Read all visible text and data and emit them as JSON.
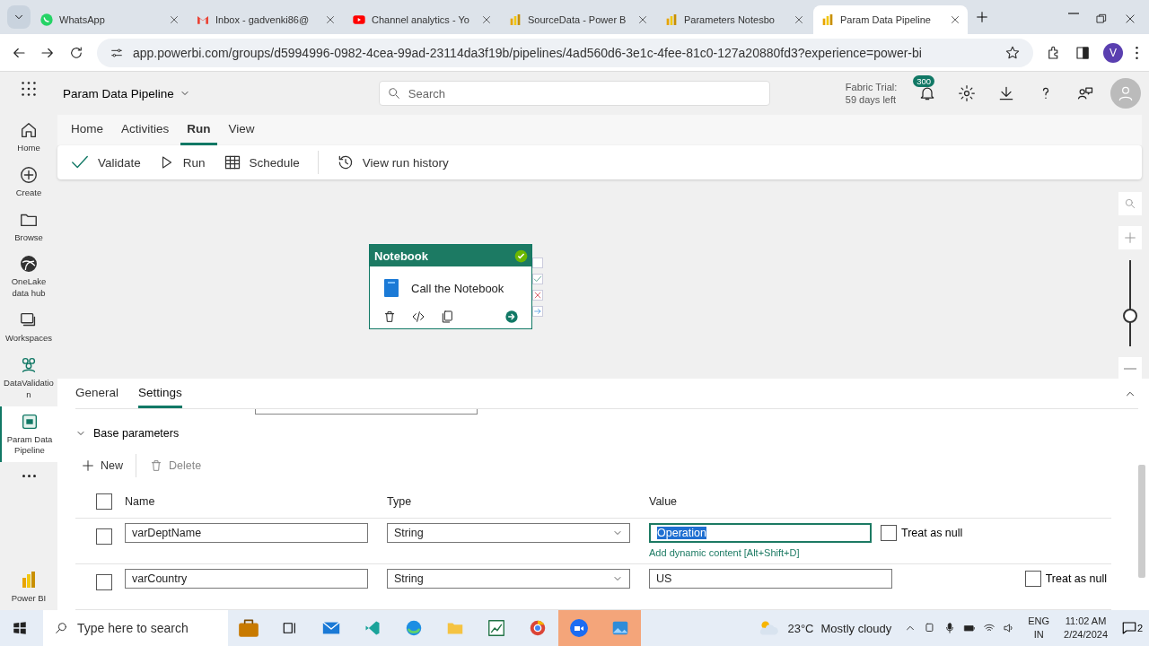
{
  "browser": {
    "tabs": [
      {
        "title": "WhatsApp",
        "kind": "whatsapp",
        "selected": false
      },
      {
        "title": "Inbox - gadvenki86@",
        "kind": "mail",
        "selected": false
      },
      {
        "title": "Channel analytics - Yo",
        "kind": "video",
        "selected": false
      },
      {
        "title": "SourceData - Power B",
        "kind": "powerbi",
        "selected": false
      },
      {
        "title": "Parameters Notesbo",
        "kind": "powerbi",
        "selected": false
      },
      {
        "title": "Param Data Pipeline",
        "kind": "powerbi",
        "selected": true
      }
    ],
    "url": "app.powerbi.com/groups/d5994996-0982-4cea-99ad-23114da3f19b/pipelines/4ad560d6-3e1c-4fee-81c0-127a20880fd3?experience=power-bi",
    "profile_initial": "V"
  },
  "app": {
    "title": "Param Data Pipeline",
    "search": {
      "placeholder": "Search"
    },
    "trial": [
      "Fabric Trial:",
      "59 days left"
    ],
    "notifications": "300"
  },
  "nav": [
    {
      "label": "Home",
      "selected": false
    },
    {
      "label": "Create",
      "selected": false
    },
    {
      "label": "Browse",
      "selected": false
    },
    {
      "label": "OneLake data hub",
      "selected": false
    },
    {
      "label": "Workspaces",
      "selected": false
    },
    {
      "label": "DataValidation",
      "selected": false
    },
    {
      "label": "Param Data Pipeline",
      "selected": true
    }
  ],
  "nav_bottom": {
    "label": "Power BI"
  },
  "ribbon": {
    "tabs": [
      {
        "label": "Home",
        "selected": false
      },
      {
        "label": "Activities",
        "selected": false
      },
      {
        "label": "Run",
        "selected": true
      },
      {
        "label": "View",
        "selected": false
      }
    ],
    "actions": [
      "Validate",
      "Run",
      "Schedule",
      "View run history"
    ]
  },
  "activity": {
    "type": "Notebook",
    "name": "Call the Notebook",
    "valid": true
  },
  "panel": {
    "tabs": [
      {
        "label": "General",
        "selected": false
      },
      {
        "label": "Settings",
        "selected": true
      }
    ],
    "section": {
      "title": "Base parameters",
      "expanded": true
    },
    "actions": [
      {
        "label": "New",
        "disabled": false
      },
      {
        "label": "Delete",
        "disabled": true
      }
    ],
    "all_selected": false,
    "columns": [
      "Name",
      "Type",
      "Value"
    ],
    "rows": [
      {
        "checked": false,
        "name": "varDeptName",
        "type": "String",
        "value": "Operation",
        "focused": true,
        "hint": "Add dynamic content [Alt+Shift+D]",
        "treat_null": false,
        "null_label": "Treat as null"
      },
      {
        "checked": false,
        "name": "varCountry",
        "type": "String",
        "value": "US",
        "focused": false,
        "treat_null": false,
        "null_label": "Treat as null"
      }
    ]
  },
  "taskbar": {
    "search_placeholder": "Type here to search",
    "temperature": "23°C",
    "condition": "Mostly cloudy",
    "language": [
      "ENG",
      "IN"
    ],
    "time": "11:02 AM",
    "date": "2/24/2024",
    "notification_count": "2"
  }
}
